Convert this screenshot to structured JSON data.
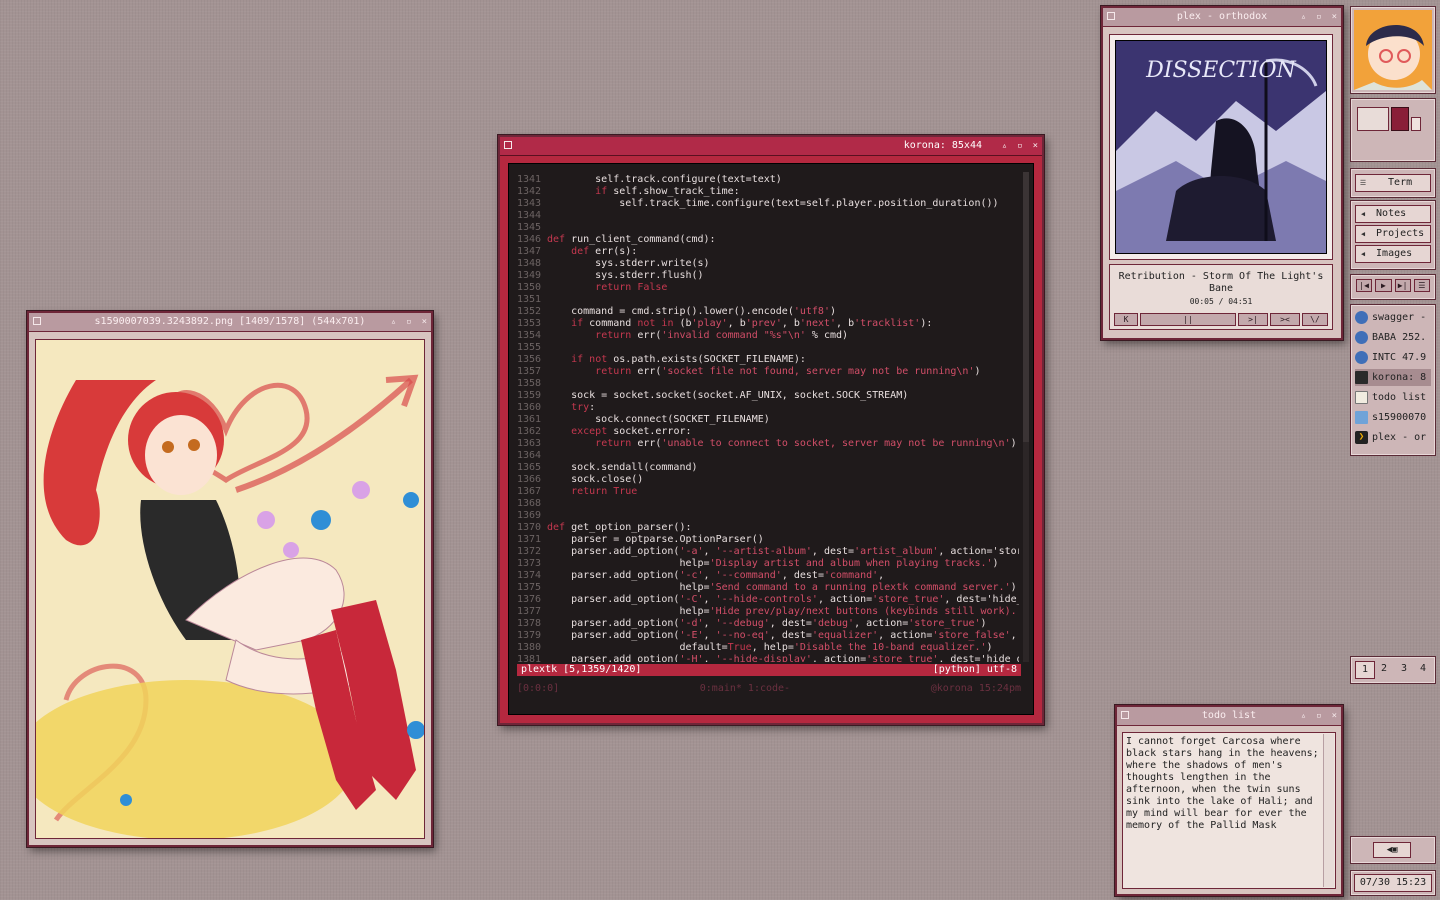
{
  "terminal": {
    "title": "korona: 85x44",
    "lines": [
      {
        "n": "1341",
        "t": "        self.track.configure(text=text)"
      },
      {
        "n": "1342",
        "t": "        if self.show_track_time:"
      },
      {
        "n": "1343",
        "t": "            self.track_time.configure(text=self.player.position_duration())"
      },
      {
        "n": "1344",
        "t": ""
      },
      {
        "n": "1345",
        "t": ""
      },
      {
        "n": "1346",
        "t": "def run_client_command(cmd):"
      },
      {
        "n": "1347",
        "t": "    def err(s):"
      },
      {
        "n": "1348",
        "t": "        sys.stderr.write(s)"
      },
      {
        "n": "1349",
        "t": "        sys.stderr.flush()"
      },
      {
        "n": "1350",
        "t": "        return False"
      },
      {
        "n": "1351",
        "t": ""
      },
      {
        "n": "1352",
        "t": "    command = cmd.strip().lower().encode('utf8')"
      },
      {
        "n": "1353",
        "t": "    if command not in (b'play', b'prev', b'next', b'tracklist'):"
      },
      {
        "n": "1354",
        "t": "        return err('invalid command \"%s\"\\n' % cmd)"
      },
      {
        "n": "1355",
        "t": ""
      },
      {
        "n": "1356",
        "t": "    if not os.path.exists(SOCKET_FILENAME):"
      },
      {
        "n": "1357",
        "t": "        return err('socket file not found, server may not be running\\n')"
      },
      {
        "n": "1358",
        "t": ""
      },
      {
        "n": "1359",
        "t": "    sock = socket.socket(socket.AF_UNIX, socket.SOCK_STREAM)"
      },
      {
        "n": "1360",
        "t": "    try:"
      },
      {
        "n": "1361",
        "t": "        sock.connect(SOCKET_FILENAME)"
      },
      {
        "n": "1362",
        "t": "    except socket.error:"
      },
      {
        "n": "1363",
        "t": "        return err('unable to connect to socket, server may not be running\\n')"
      },
      {
        "n": "1364",
        "t": ""
      },
      {
        "n": "1365",
        "t": "    sock.sendall(command)"
      },
      {
        "n": "1366",
        "t": "    sock.close()"
      },
      {
        "n": "1367",
        "t": "    return True"
      },
      {
        "n": "1368",
        "t": ""
      },
      {
        "n": "1369",
        "t": ""
      },
      {
        "n": "1370",
        "t": "def get_option_parser():"
      },
      {
        "n": "1371",
        "t": "    parser = optparse.OptionParser()"
      },
      {
        "n": "1372",
        "t": "    parser.add_option('-a', '--artist-album', dest='artist_album', action='store"
      },
      {
        "n": "1373",
        "t": "                      help='Display artist and album when playing tracks.')"
      },
      {
        "n": "1374",
        "t": "    parser.add_option('-c', '--command', dest='command',"
      },
      {
        "n": "1375",
        "t": "                      help='Send command to a running plextk command server.')"
      },
      {
        "n": "1376",
        "t": "    parser.add_option('-C', '--hide-controls', action='store_true', dest='hide_c"
      },
      {
        "n": "1377",
        "t": "                      help='Hide prev/play/next buttons (keybinds still work).')"
      },
      {
        "n": "1378",
        "t": "    parser.add_option('-d', '--debug', dest='debug', action='store_true')"
      },
      {
        "n": "1379",
        "t": "    parser.add_option('-E', '--no-eq', dest='equalizer', action='store_false',"
      },
      {
        "n": "1380",
        "t": "                      default=True, help='Disable the 10-band equalizer.')"
      },
      {
        "n": "1381",
        "t": "    parser.add_option('-H', '--hide-display', action='store_true', dest='hide_d"
      }
    ],
    "status_left": "plextk  [5,1359/1420]",
    "status_right": "[python] utf-8",
    "tmux_left": "[0:0:0]",
    "tmux_center": "0:main* 1:code-",
    "tmux_right": "@korona 15:24pm"
  },
  "image_viewer": {
    "title": "s1590007039.3243892.png [1409/1578] (544x701)"
  },
  "plex": {
    "title": "plex - orthodox",
    "track": "Retribution - Storm Of The Light's Bane",
    "time": "00:05 / 04:51",
    "buttons": [
      "K",
      "||",
      ">|",
      "><",
      "\\/"
    ]
  },
  "todo": {
    "title": "todo list",
    "text": "I cannot forget Carcosa where black stars hang in the heavens; where the shadows of men's thoughts lengthen in the afternoon, when the twin suns sink into the lake of Hali; and my mind will bear for ever the memory of the Pallid Mask"
  },
  "dock": {
    "term_label": "Term",
    "menu": [
      "Notes",
      "Projects",
      "Images"
    ],
    "tasks": [
      "swagger -",
      "BABA 252.",
      "INTC 47.9",
      "korona: 8",
      "todo list",
      "s15900070",
      "plex - or"
    ],
    "workspaces": [
      "1",
      "2",
      "3",
      "4"
    ],
    "clock": "07/30 15:23"
  },
  "colors": {
    "accent": "#b5283f",
    "desktop": "#a39393",
    "window": "#d8c4c0"
  }
}
